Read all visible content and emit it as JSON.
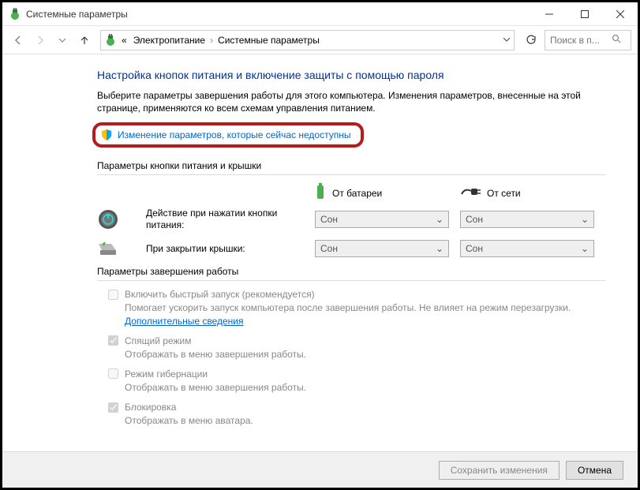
{
  "window": {
    "title": "Системные параметры"
  },
  "breadcrumb": {
    "prefix": "«",
    "item1": "Электропитание",
    "item2": "Системные параметры"
  },
  "search": {
    "placeholder": "Поиск в п..."
  },
  "page": {
    "title": "Настройка кнопок питания и включение защиты с помощью пароля",
    "desc": "Выберите параметры завершения работы для этого компьютера. Изменения параметров, внесенные на этой странице, применяются ко всем схемам управления питанием.",
    "unlock_link": "Изменение параметров, которые сейчас недоступны"
  },
  "sections": {
    "buttons_lid": "Параметры кнопки питания и крышки",
    "shutdown": "Параметры завершения работы"
  },
  "columns": {
    "battery": "От батареи",
    "plugged": "От сети"
  },
  "rows": {
    "power_button": {
      "label": "Действие при нажатии кнопки питания:",
      "battery": "Сон",
      "plugged": "Сон"
    },
    "lid_close": {
      "label": "При закрытии крышки:",
      "battery": "Сон",
      "plugged": "Сон"
    }
  },
  "options": {
    "fast_startup": {
      "label": "Включить быстрый запуск (рекомендуется)",
      "desc": "Помогает ускорить запуск компьютера после завершения работы. Не влияет на режим перезагрузки. ",
      "link": "Дополнительные сведения",
      "checked": false
    },
    "sleep": {
      "label": "Спящий режим",
      "desc": "Отображать в меню завершения работы.",
      "checked": true
    },
    "hibernate": {
      "label": "Режим гибернации",
      "desc": "Отображать в меню завершения работы.",
      "checked": false
    },
    "lock": {
      "label": "Блокировка",
      "desc": "Отображать в меню аватара.",
      "checked": true
    }
  },
  "footer": {
    "save": "Сохранить изменения",
    "cancel": "Отмена"
  }
}
